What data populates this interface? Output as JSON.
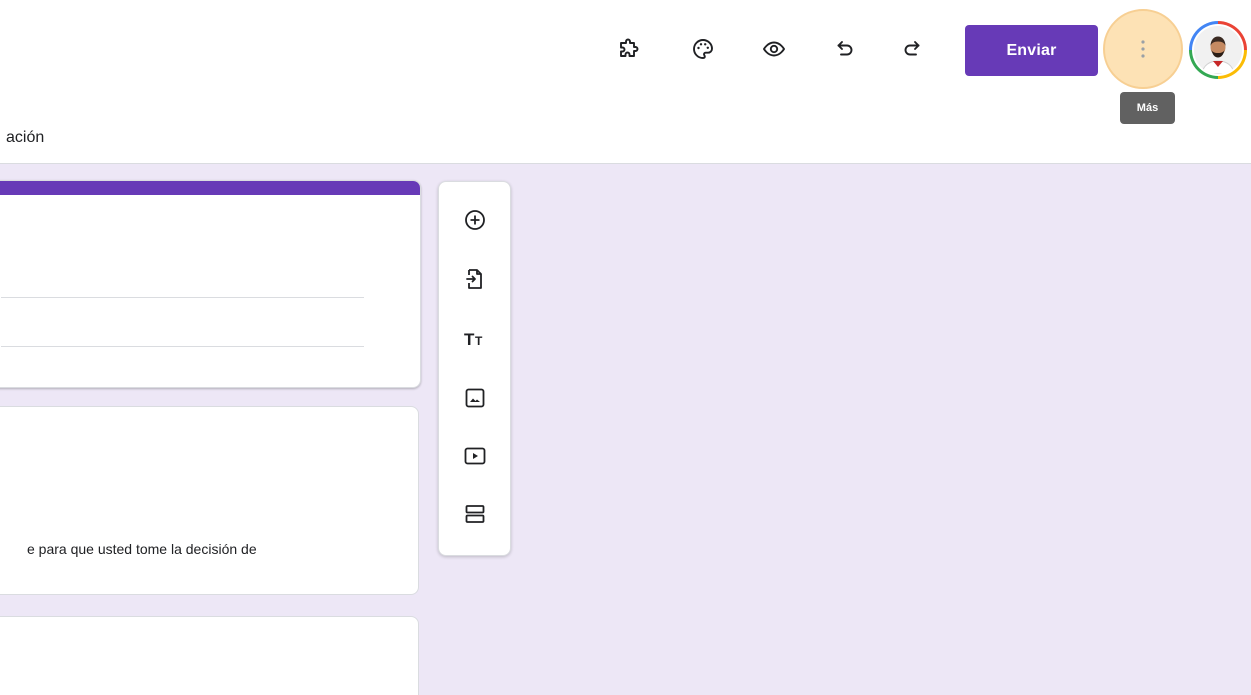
{
  "toolbar": {
    "icons": [
      "addons-icon",
      "palette-icon",
      "preview-eye-icon",
      "undo-icon",
      "redo-icon"
    ],
    "send_label": "Enviar",
    "more_icon": "more-vert-icon",
    "more_tooltip": "Más"
  },
  "tabs": {
    "partial_label": "ación"
  },
  "cards": {
    "description_partial": "e para que usted tome la decisión de"
  },
  "side_toolbar": {
    "icons": [
      "add-question-icon",
      "import-questions-icon",
      "add-title-icon",
      "add-image-icon",
      "add-video-icon",
      "add-section-icon"
    ]
  },
  "colors": {
    "accent": "#673ab7",
    "page_background": "#ede7f6",
    "more_highlight": "#fde2b5",
    "tooltip_bg": "#616161"
  }
}
